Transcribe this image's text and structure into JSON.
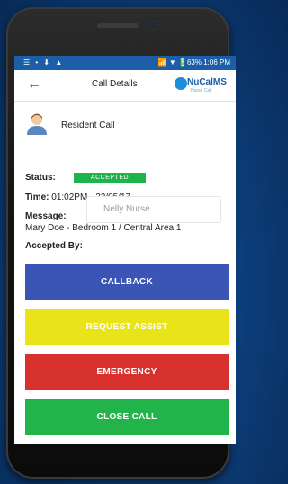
{
  "status_bar": {
    "left_icons": "☰ • ⬇ ▲",
    "right_text": "📶 ▼ 🔋63% 1:06 PM"
  },
  "app_bar": {
    "back_icon": "←",
    "title": "Call Details",
    "logo_text": "NuCalMS",
    "logo_sub": "Nurse Call"
  },
  "details": {
    "call_type": "Resident Call",
    "status_label": "Status:",
    "status_value": "ACCEPTED",
    "time_label": "Time:",
    "time_value": "01:02PM - 22/05/17",
    "message_label": "Message:",
    "message_value": "Mary Doe - Bedroom 1 / Central Area 1",
    "accepted_by_label": "Accepted By:",
    "accepted_by_value": "Nelly Nurse"
  },
  "buttons": {
    "callback": "CALLBACK",
    "request_assist": "REQUEST ASSIST",
    "emergency": "EMERGENCY",
    "close_call": "CLOSE CALL"
  },
  "colors": {
    "callback": "#3a55b4",
    "request_assist": "#e9e419",
    "emergency": "#d6312c",
    "close_call": "#22b34a",
    "accepted_badge": "#1db44c"
  }
}
